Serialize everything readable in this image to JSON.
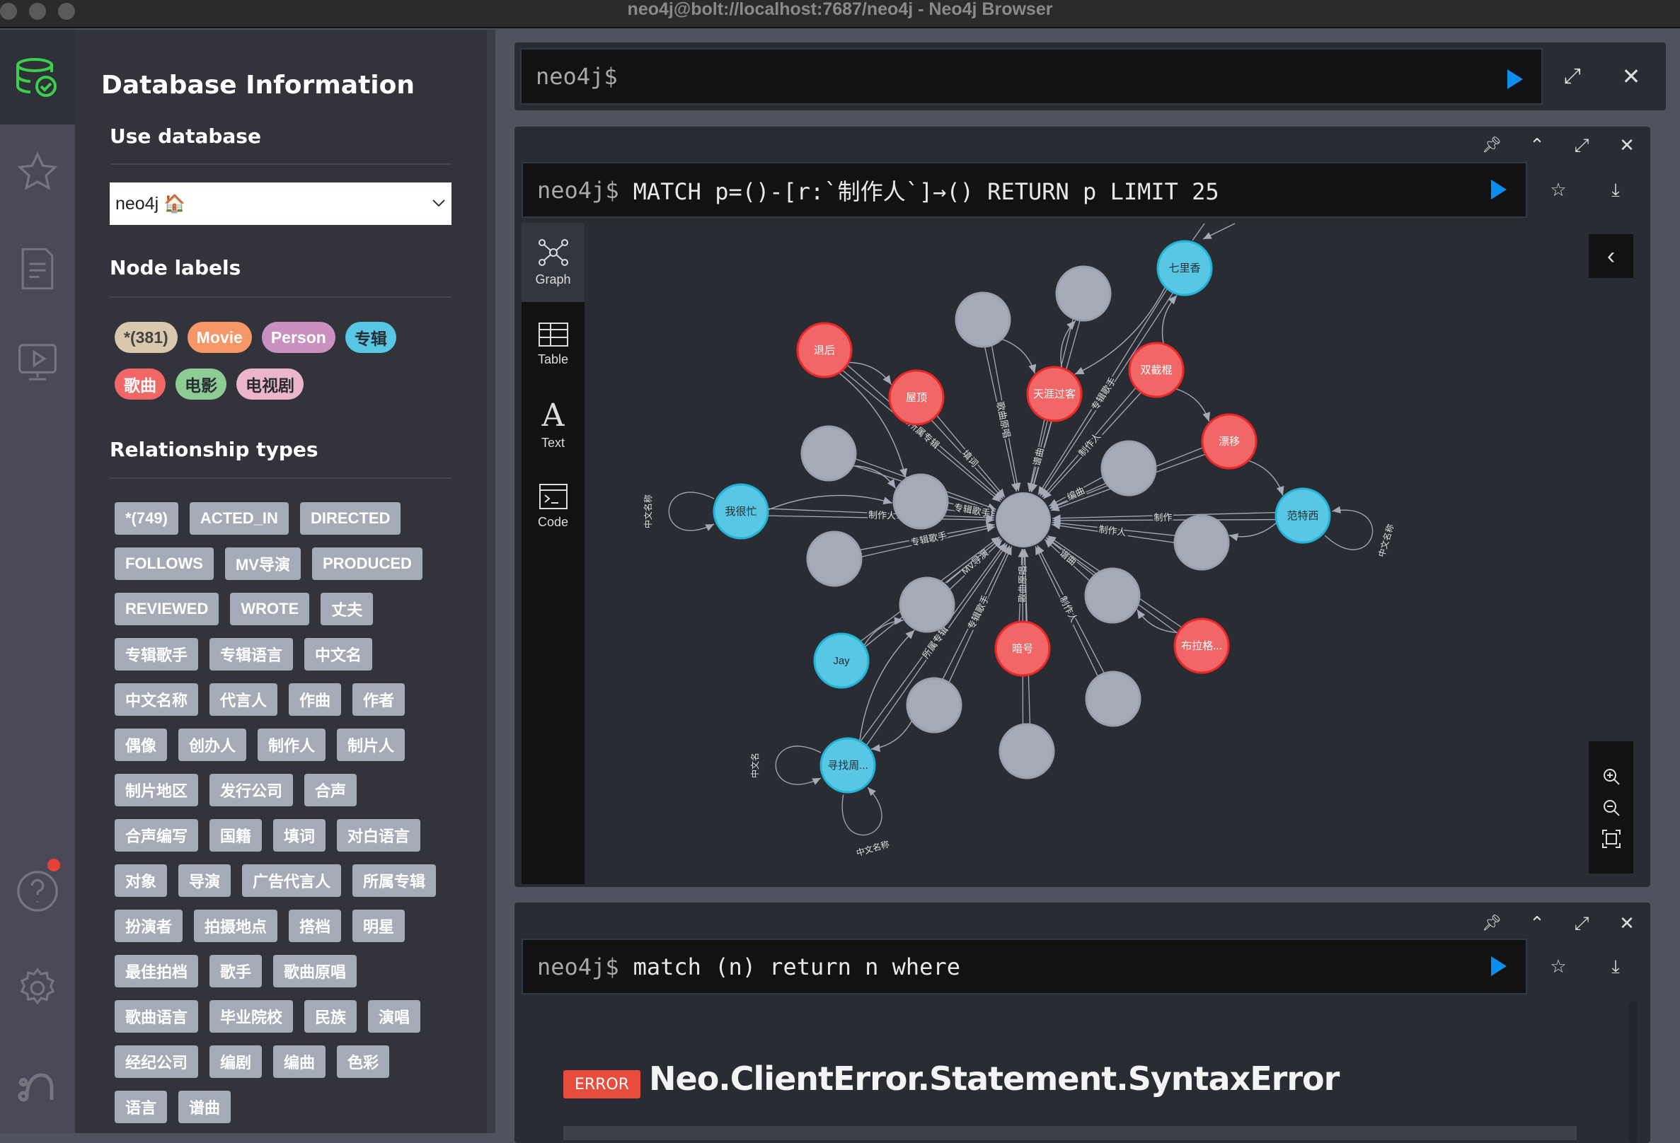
{
  "window": {
    "title": "neo4j@bolt://localhost:7687/neo4j - Neo4j Browser"
  },
  "sidebar": {
    "title": "Database Information",
    "use_database": "Use database",
    "database_value": "neo4j 🏠",
    "node_labels_title": "Node labels",
    "node_labels": [
      {
        "label": "*(381)",
        "bg": "#d9c8ae",
        "fg": "#444444"
      },
      {
        "label": "Movie",
        "bg": "#f79767",
        "fg": "#ffffff"
      },
      {
        "label": "Person",
        "bg": "#c990c0",
        "fg": "#ffffff"
      },
      {
        "label": "专辑",
        "bg": "#57c7e3",
        "fg": "#2a2c34"
      },
      {
        "label": "歌曲",
        "bg": "#f16667",
        "fg": "#ffffff"
      },
      {
        "label": "电影",
        "bg": "#8dcc93",
        "fg": "#2a2c34"
      },
      {
        "label": "电视剧",
        "bg": "#ecb5c9",
        "fg": "#2a2c34"
      }
    ],
    "rel_types_title": "Relationship types",
    "rel_types": [
      "*(749)",
      "ACTED_IN",
      "DIRECTED",
      "FOLLOWS",
      "MV导演",
      "PRODUCED",
      "REVIEWED",
      "WROTE",
      "丈夫",
      "专辑歌手",
      "专辑语言",
      "中文名",
      "中文名称",
      "代言人",
      "作曲",
      "作者",
      "偶像",
      "创办人",
      "制作人",
      "制片人",
      "制片地区",
      "发行公司",
      "合声",
      "合声编写",
      "国籍",
      "填词",
      "对白语言",
      "对象",
      "导演",
      "广告代言人",
      "所属专辑",
      "扮演者",
      "拍摄地点",
      "搭档",
      "明星",
      "最佳拍档",
      "歌手",
      "歌曲原唱",
      "歌曲语言",
      "毕业院校",
      "民族",
      "演唱",
      "经纪公司",
      "编剧",
      "编曲",
      "色彩",
      "语言",
      "谱曲"
    ]
  },
  "top_editor": {
    "prompt": "neo4j$"
  },
  "frame1": {
    "prompt": "neo4j$",
    "query": "MATCH p=()-[r:`制作人`]→() RETURN p LIMIT 25",
    "tabs": [
      "Graph",
      "Table",
      "Text",
      "Code"
    ],
    "graph": {
      "center_caption": "",
      "nodes": [
        {
          "caption": "七里香",
          "type": "album"
        },
        {
          "caption": "",
          "type": "other"
        },
        {
          "caption": "",
          "type": "other"
        },
        {
          "caption": "退后",
          "type": "song"
        },
        {
          "caption": "屋顶",
          "type": "song"
        },
        {
          "caption": "天涯过客",
          "type": "song"
        },
        {
          "caption": "双截棍",
          "type": "song"
        },
        {
          "caption": "漂移",
          "type": "song"
        },
        {
          "caption": "",
          "type": "other"
        },
        {
          "caption": "",
          "type": "other"
        },
        {
          "caption": "",
          "type": "other"
        },
        {
          "caption": "我很忙",
          "type": "album"
        },
        {
          "caption": "范特西",
          "type": "album"
        },
        {
          "caption": "",
          "type": "other"
        },
        {
          "caption": "",
          "type": "other"
        },
        {
          "caption": "",
          "type": "other"
        },
        {
          "caption": "",
          "type": "other"
        },
        {
          "caption": "Jay",
          "type": "album"
        },
        {
          "caption": "暗号",
          "type": "song"
        },
        {
          "caption": "布拉格...",
          "type": "song"
        },
        {
          "caption": "",
          "type": "other"
        },
        {
          "caption": "",
          "type": "other"
        },
        {
          "caption": "",
          "type": "other"
        },
        {
          "caption": "寻找周...",
          "type": "album"
        }
      ],
      "edge_labels": [
        "专辑歌手",
        "制作人",
        "歌曲原唱",
        "所属专辑",
        "填词",
        "谱曲",
        "制作人",
        "制作人",
        "歌曲原唱",
        "编曲",
        "专辑歌手",
        "制作人",
        "制作",
        "专辑歌手",
        "制作人",
        "MV导演",
        "谱曲",
        "制作人",
        "歌曲原唱",
        "制作人",
        "专辑歌手",
        "制作人",
        "谱曲",
        "所属专辑"
      ],
      "loop_labels": [
        "中文名称",
        "中文名称",
        "中文名",
        "中文名称"
      ],
      "colors": {
        "song": "#f16667",
        "album": "#57c7e3",
        "other": "#a5abb6"
      }
    }
  },
  "frame2": {
    "prompt": "neo4j$",
    "query": "match (n) return n where",
    "error_badge": "ERROR",
    "error_title": "Neo.ClientError.Statement.SyntaxError"
  }
}
